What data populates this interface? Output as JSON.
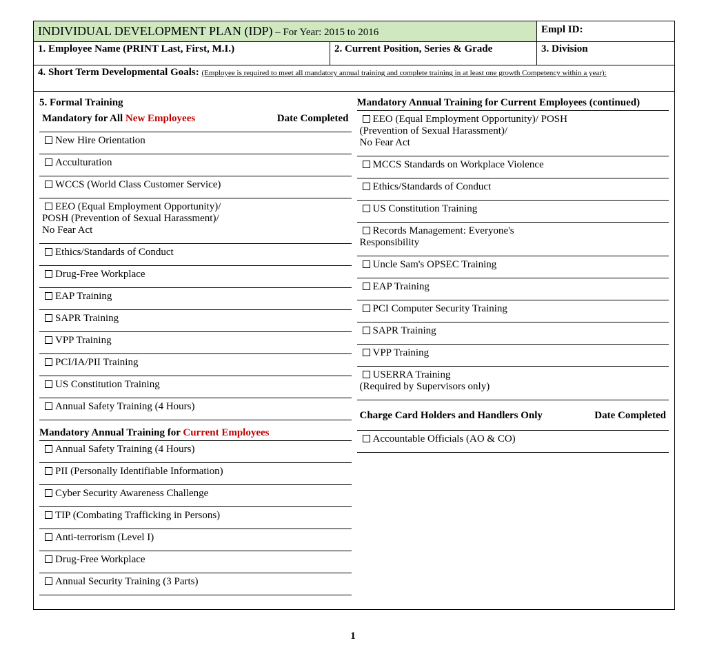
{
  "title_main": "INDIVIDUAL DEVELOPMENT PLAN (IDP)",
  "title_year": " – For Year: 2015 to 2016",
  "empl_id_label": "Empl ID:",
  "row2": {
    "c1": "1. Employee Name (PRINT Last, First, M.I.)",
    "c2": "2. Current Position, Series & Grade",
    "c3": "3. Division"
  },
  "goals": {
    "label": "4. Short Term Developmental Goals: ",
    "note": "(Employee is required to meet all  mandatory annual training and complete training in at least one growth Competency within a year):"
  },
  "sec5": {
    "heading": "5. Formal Training",
    "sub1a": "Mandatory for All ",
    "sub1b": "New Employees",
    "datecol": "Date Completed"
  },
  "new_emp": {
    "i0": "New Hire Orientation",
    "i1": "Acculturation",
    "i2": "WCCS (World Class Customer Service)",
    "i3a": "EEO (Equal Employment Opportunity)/",
    "i3b": "POSH (Prevention of Sexual Harassment)/",
    "i3c": "No Fear Act",
    "i4": "Ethics/Standards of Conduct",
    "i5": "Drug-Free Workplace",
    "i6": "EAP Training",
    "i7": "SAPR Training",
    "i8": "VPP Training",
    "i9": "PCI/IA/PII Training",
    "i10": "US Constitution Training",
    "i11": "Annual Safety Training (4 Hours)"
  },
  "cur_hdr_a": "Mandatory Annual Training for ",
  "cur_hdr_b": "Current Employees",
  "cur_emp": {
    "i0": "Annual Safety Training (4 Hours)",
    "i1": "PII (Personally Identifiable Information)",
    "i2": "Cyber Security Awareness Challenge",
    "i3": "TIP (Combating Trafficking in Persons)",
    "i4": "Anti-terrorism (Level I)",
    "i5": "Drug-Free Workplace",
    "i6": "Annual Security Training (3 Parts)"
  },
  "right_hdr": "Mandatory Annual Training for Current Employees (continued)",
  "right": {
    "i0a": "EEO (Equal Employment Opportunity)/ POSH",
    "i0b": "(Prevention of Sexual Harassment)/",
    "i0c": "No Fear Act",
    "i1": "MCCS Standards on Workplace Violence",
    "i2": "Ethics/Standards of Conduct",
    "i3": "US Constitution Training",
    "i4a": "Records Management: Everyone's",
    "i4b": "Responsibility",
    "i5": "Uncle Sam's OPSEC Training",
    "i6": "EAP Training",
    "i7": "PCI Computer Security Training",
    "i8": "SAPR Training",
    "i9": "VPP Training",
    "i10": "USERRA Training",
    "i10note": "(Required by Supervisors only)"
  },
  "charge_hdr": "Charge Card Holders and Handlers Only",
  "charge_date": "Date Completed",
  "charge": {
    "i0": "Accountable Officials (AO & CO)"
  },
  "pagenum": "1"
}
